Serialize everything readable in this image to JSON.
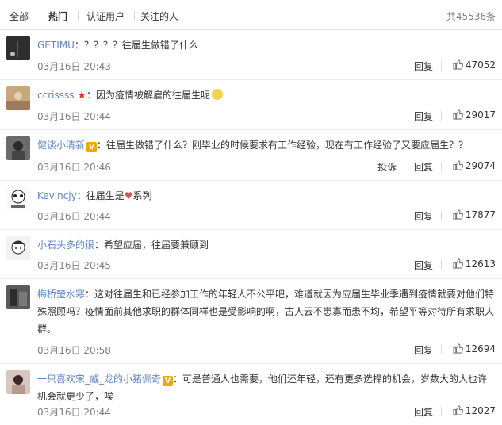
{
  "tabs": [
    {
      "label": "全部"
    },
    {
      "label": "热门"
    },
    {
      "label": "认证用户"
    },
    {
      "label": "关注的人"
    }
  ],
  "total": "共45536条",
  "comments": [
    {
      "user": "GETIMU",
      "text": "？？？？往届生做错了什么",
      "time": "03月16日 20:43",
      "reply": "回复",
      "likes": "47052"
    },
    {
      "user": "ccrissss",
      "text": "因为疫情被解雇的往届生呢",
      "time": "03月16日 20:44",
      "reply": "回复",
      "likes": "29017"
    },
    {
      "user": "健谈小清新",
      "text": "往届生做错了什么？刚毕业的时候要求有工作经验，现在有工作经验了又要应届生？？",
      "time": "03月16日 20:46",
      "report": "投诉",
      "reply": "回复",
      "likes": "29074"
    },
    {
      "user": "Kevincjy",
      "text": "往届生是",
      "text2": "系列",
      "time": "03月16日 20:44",
      "reply": "回复",
      "likes": "17877"
    },
    {
      "user": "小石头多的很",
      "text": "希望应届，往届要兼顾到",
      "time": "03月16日 20:45",
      "reply": "回复",
      "likes": "12613"
    },
    {
      "user": "梅桥楚水寒",
      "text": "这对往届生和已经参加工作的年轻人不公平吧，难道就因为应届生毕业季遇到疫情就要对他们特殊照顾吗？疫情面前其他求职的群体同样也是受影响的啊，古人云不患寡而患不均，希望平等对待所有求职人群。",
      "time": "03月16日 20:58",
      "reply": "回复",
      "likes": "12694"
    },
    {
      "user": "一只喜欢宋_威_龙的小猪佩奇",
      "text": "可是普通人也需要，他们还年轻，还有更多选择的机会，岁数大的人也许机会就更少了，唉",
      "time": "03月16日 20:44",
      "reply": "回复",
      "likes": "12027"
    }
  ],
  "colors": {
    "link": "#5d87c7",
    "meta": "#808080",
    "vip": "#f3a500",
    "red": "#e7301c"
  }
}
